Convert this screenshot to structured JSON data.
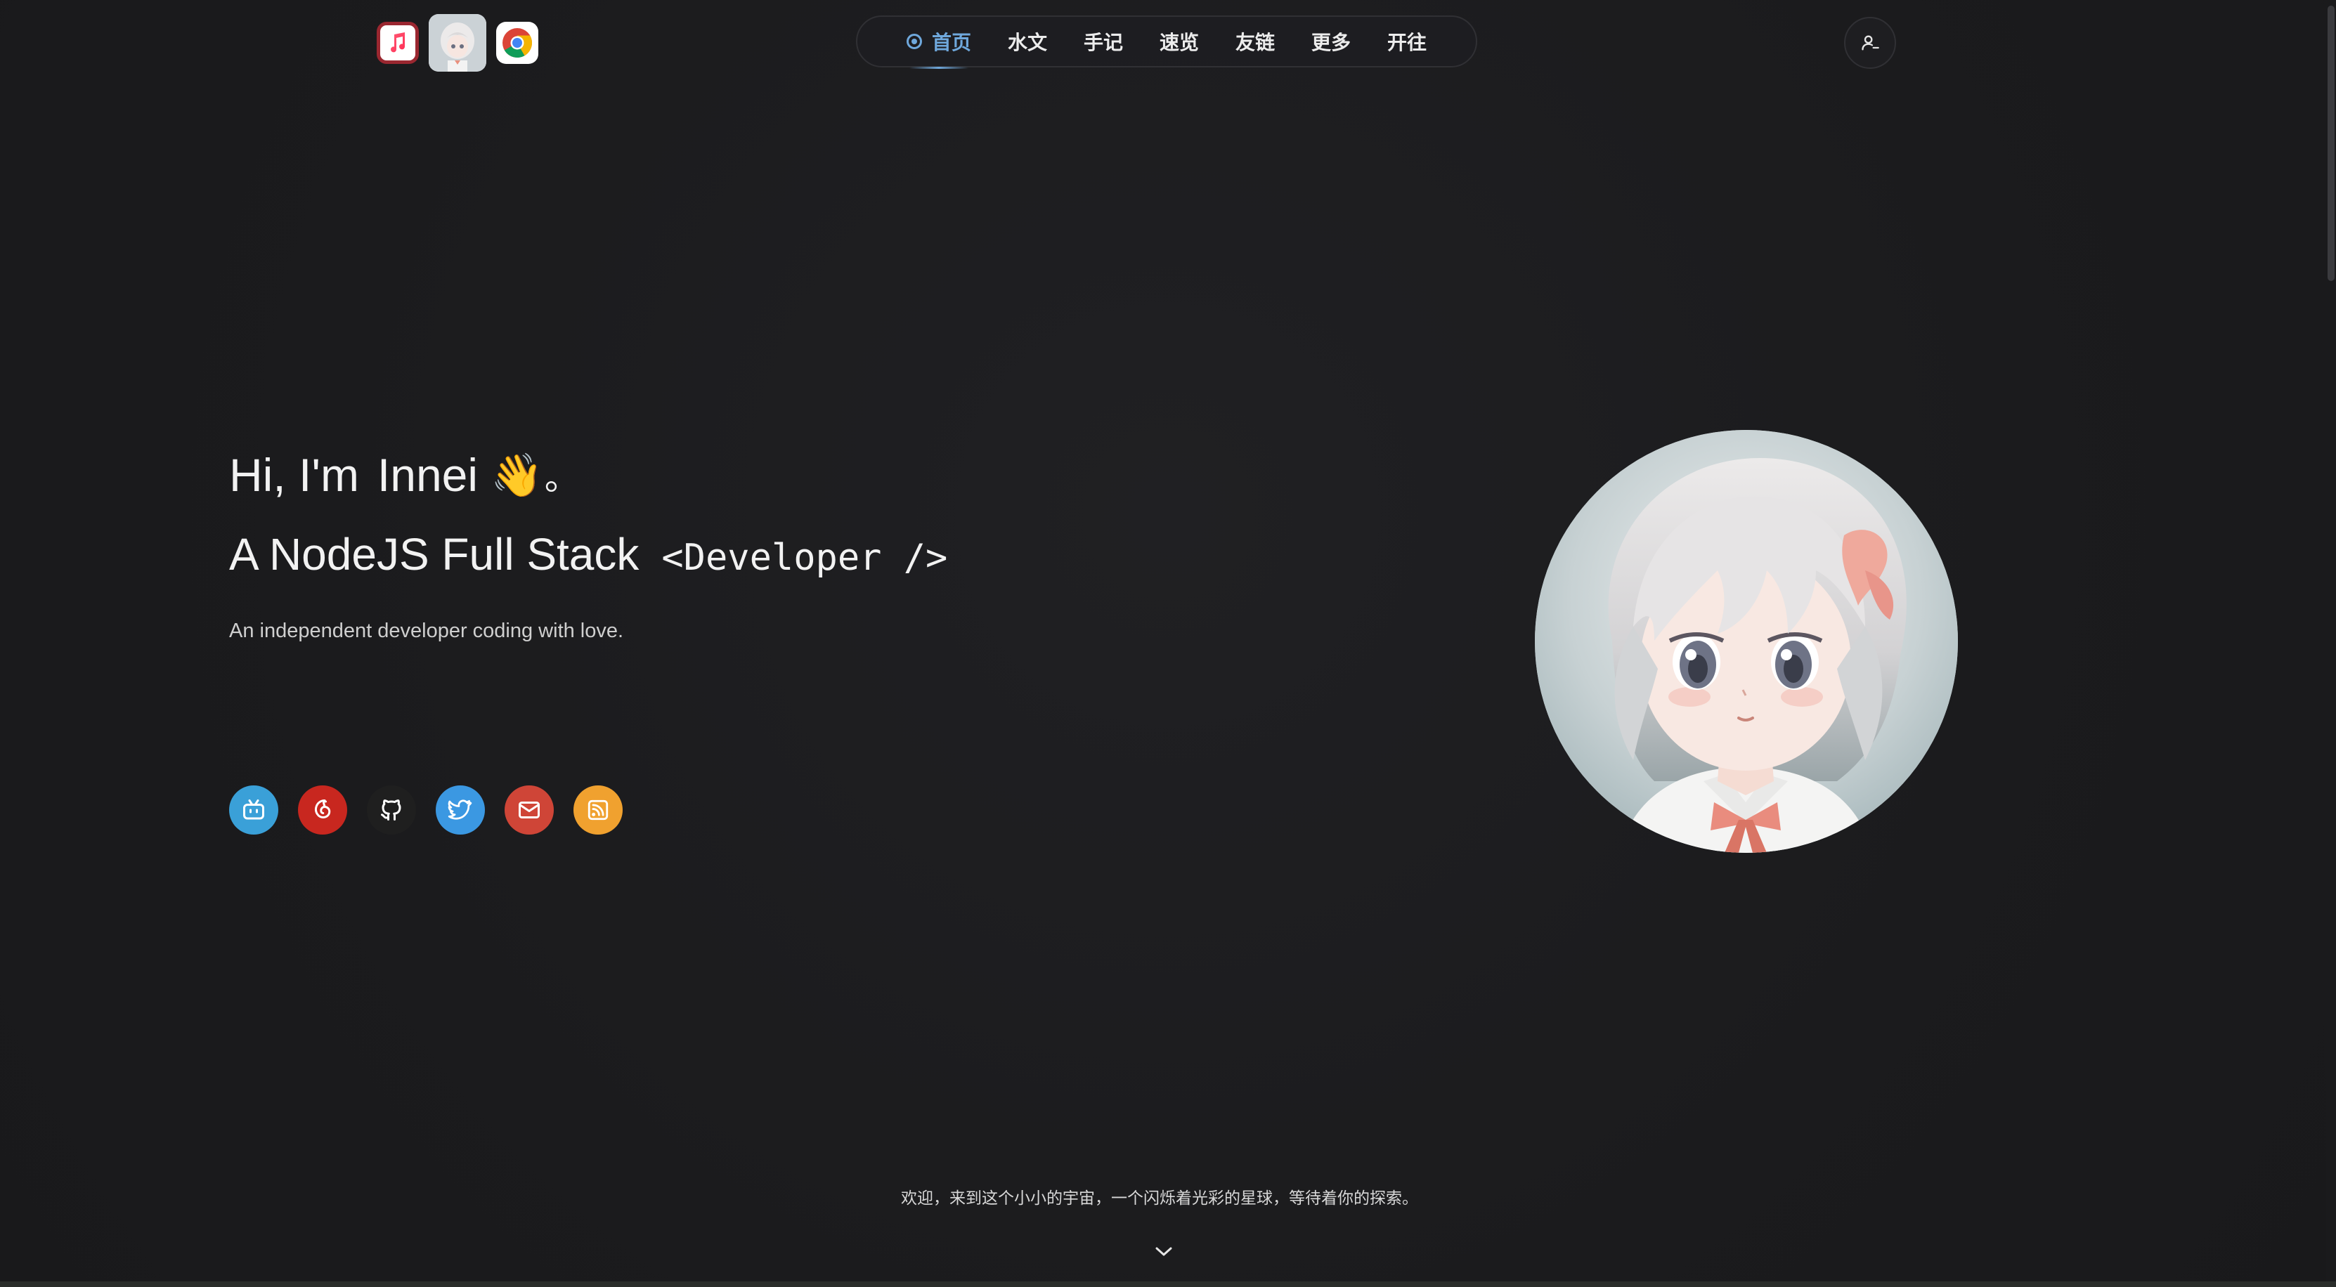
{
  "header": {
    "app_icons": [
      {
        "name": "music-icon"
      },
      {
        "name": "avatar-app-icon"
      },
      {
        "name": "chrome-icon"
      }
    ],
    "nav": [
      {
        "label": "首页",
        "active": true
      },
      {
        "label": "水文",
        "active": false
      },
      {
        "label": "手记",
        "active": false
      },
      {
        "label": "速览",
        "active": false
      },
      {
        "label": "友链",
        "active": false
      },
      {
        "label": "更多",
        "active": false
      },
      {
        "label": "开往",
        "active": false
      }
    ],
    "user_icon": "user-login-icon"
  },
  "hero": {
    "greeting": "Hi, I'm",
    "name": "Innei",
    "wave": "👋",
    "period": "。",
    "role": "A NodeJS Full Stack",
    "role_code": "<Developer />",
    "subtitle": "An independent developer coding with love."
  },
  "socials": [
    {
      "name": "bilibili-icon",
      "color": "#3aa0d8"
    },
    {
      "name": "netease-music-icon",
      "color": "#c8271f"
    },
    {
      "name": "github-icon",
      "color": "#1f1f1f"
    },
    {
      "name": "twitter-icon",
      "color": "#3b98e2"
    },
    {
      "name": "email-icon",
      "color": "#cf4537"
    },
    {
      "name": "rss-icon",
      "color": "#f0a12f"
    }
  ],
  "footer": {
    "text": "欢迎，来到这个小小的宇宙，一个闪烁着光彩的星球，等待着你的探索。",
    "scroll_icon": "chevron-down-icon"
  },
  "colors": {
    "background": "#1b1b1d",
    "accent": "#6fa8dc"
  }
}
